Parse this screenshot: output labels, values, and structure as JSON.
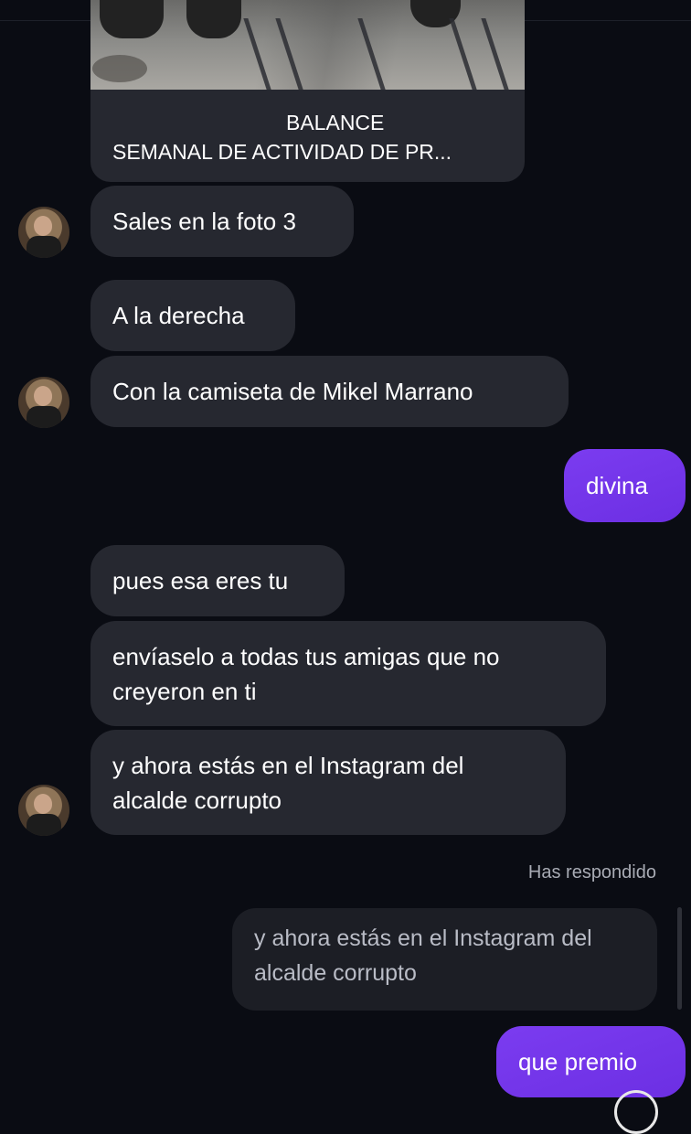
{
  "shared_post": {
    "caption_line1": "BALANCE",
    "caption_line2": "SEMANAL DE ACTIVIDAD DE PR..."
  },
  "messages": [
    {
      "side": "received",
      "text": "Sales en la foto 3"
    },
    {
      "side": "received",
      "text": "A la derecha"
    },
    {
      "side": "received",
      "text": "Con la camiseta de Mikel Marrano"
    },
    {
      "side": "sent",
      "text": "divina"
    },
    {
      "side": "received",
      "text": "pues esa eres tu"
    },
    {
      "side": "received",
      "text_line1": "envíaselo a todas tus amigas que no",
      "text_line2": "creyeron en ti"
    },
    {
      "side": "received",
      "text_line1": "y ahora estás en el Instagram del",
      "text_line2": "alcalde corrupto"
    },
    {
      "side": "sent",
      "text": "que premio"
    }
  ],
  "reply": {
    "label": "Has respondido",
    "quote_line1": "y ahora estás en el Instagram del",
    "quote_line2": "alcalde corrupto"
  },
  "colors": {
    "background": "#0a0c13",
    "received_bubble": "#262830",
    "sent_bubble": "#7c3aed",
    "reply_quote": "#1c1e25"
  }
}
